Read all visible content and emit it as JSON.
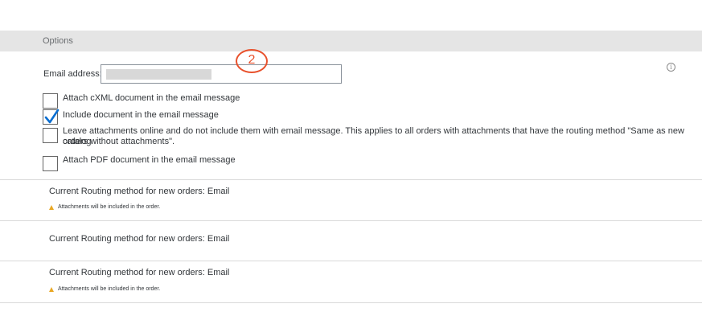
{
  "options": {
    "title": "Options"
  },
  "email": {
    "label": "Email address:",
    "value": ""
  },
  "callout": {
    "number": "2"
  },
  "info_icon": {
    "glyph": "i"
  },
  "checkboxes": [
    {
      "label": "Attach cXML document in the email message",
      "checked": false
    },
    {
      "label": "Include document in the email message",
      "checked": true
    },
    {
      "label_line1": "Leave attachments online and do not include them with email message.  This applies to all orders with attachments that have the routing method \"Same as new catalog",
      "label_line2": "orders without attachments\".",
      "checked": false
    },
    {
      "label": "Attach PDF document in the email message",
      "checked": false
    }
  ],
  "routing_blocks": [
    {
      "method_text": "Current Routing method for new orders: Email",
      "warning": "Attachments will be included in the order."
    },
    {
      "method_text": "Current Routing method for new orders: Email",
      "warning": ""
    },
    {
      "method_text": "Current Routing method for new orders: Email",
      "warning": "Attachments will be included in the order."
    }
  ],
  "colors": {
    "accent": "#0a6ed1",
    "callout": "#e8512c",
    "warning": "#e9a825"
  }
}
